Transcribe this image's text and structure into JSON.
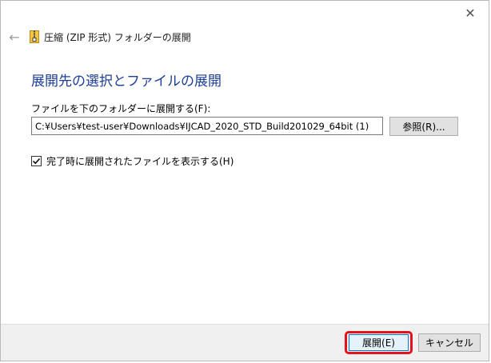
{
  "window": {
    "title": "圧縮 (ZIP 形式) フォルダーの展開",
    "close_glyph": "✕",
    "back_glyph": "←"
  },
  "main": {
    "heading": "展開先の選択とファイルの展開",
    "dest_label": "ファイルを下のフォルダーに展開する(F):",
    "dest_path": "C:¥Users¥test-user¥Downloads¥IJCAD_2020_STD_Build201029_64bit (1)",
    "browse_label": "参照(R)...",
    "show_files_label": "完了時に展開されたファイルを表示する(H)",
    "show_files_checked": true
  },
  "footer": {
    "extract_label": "展開(E)",
    "cancel_label": "キャンセル"
  },
  "colors": {
    "heading": "#1e3f9a",
    "highlight": "#e3131d",
    "primary_border": "#0078d7"
  }
}
